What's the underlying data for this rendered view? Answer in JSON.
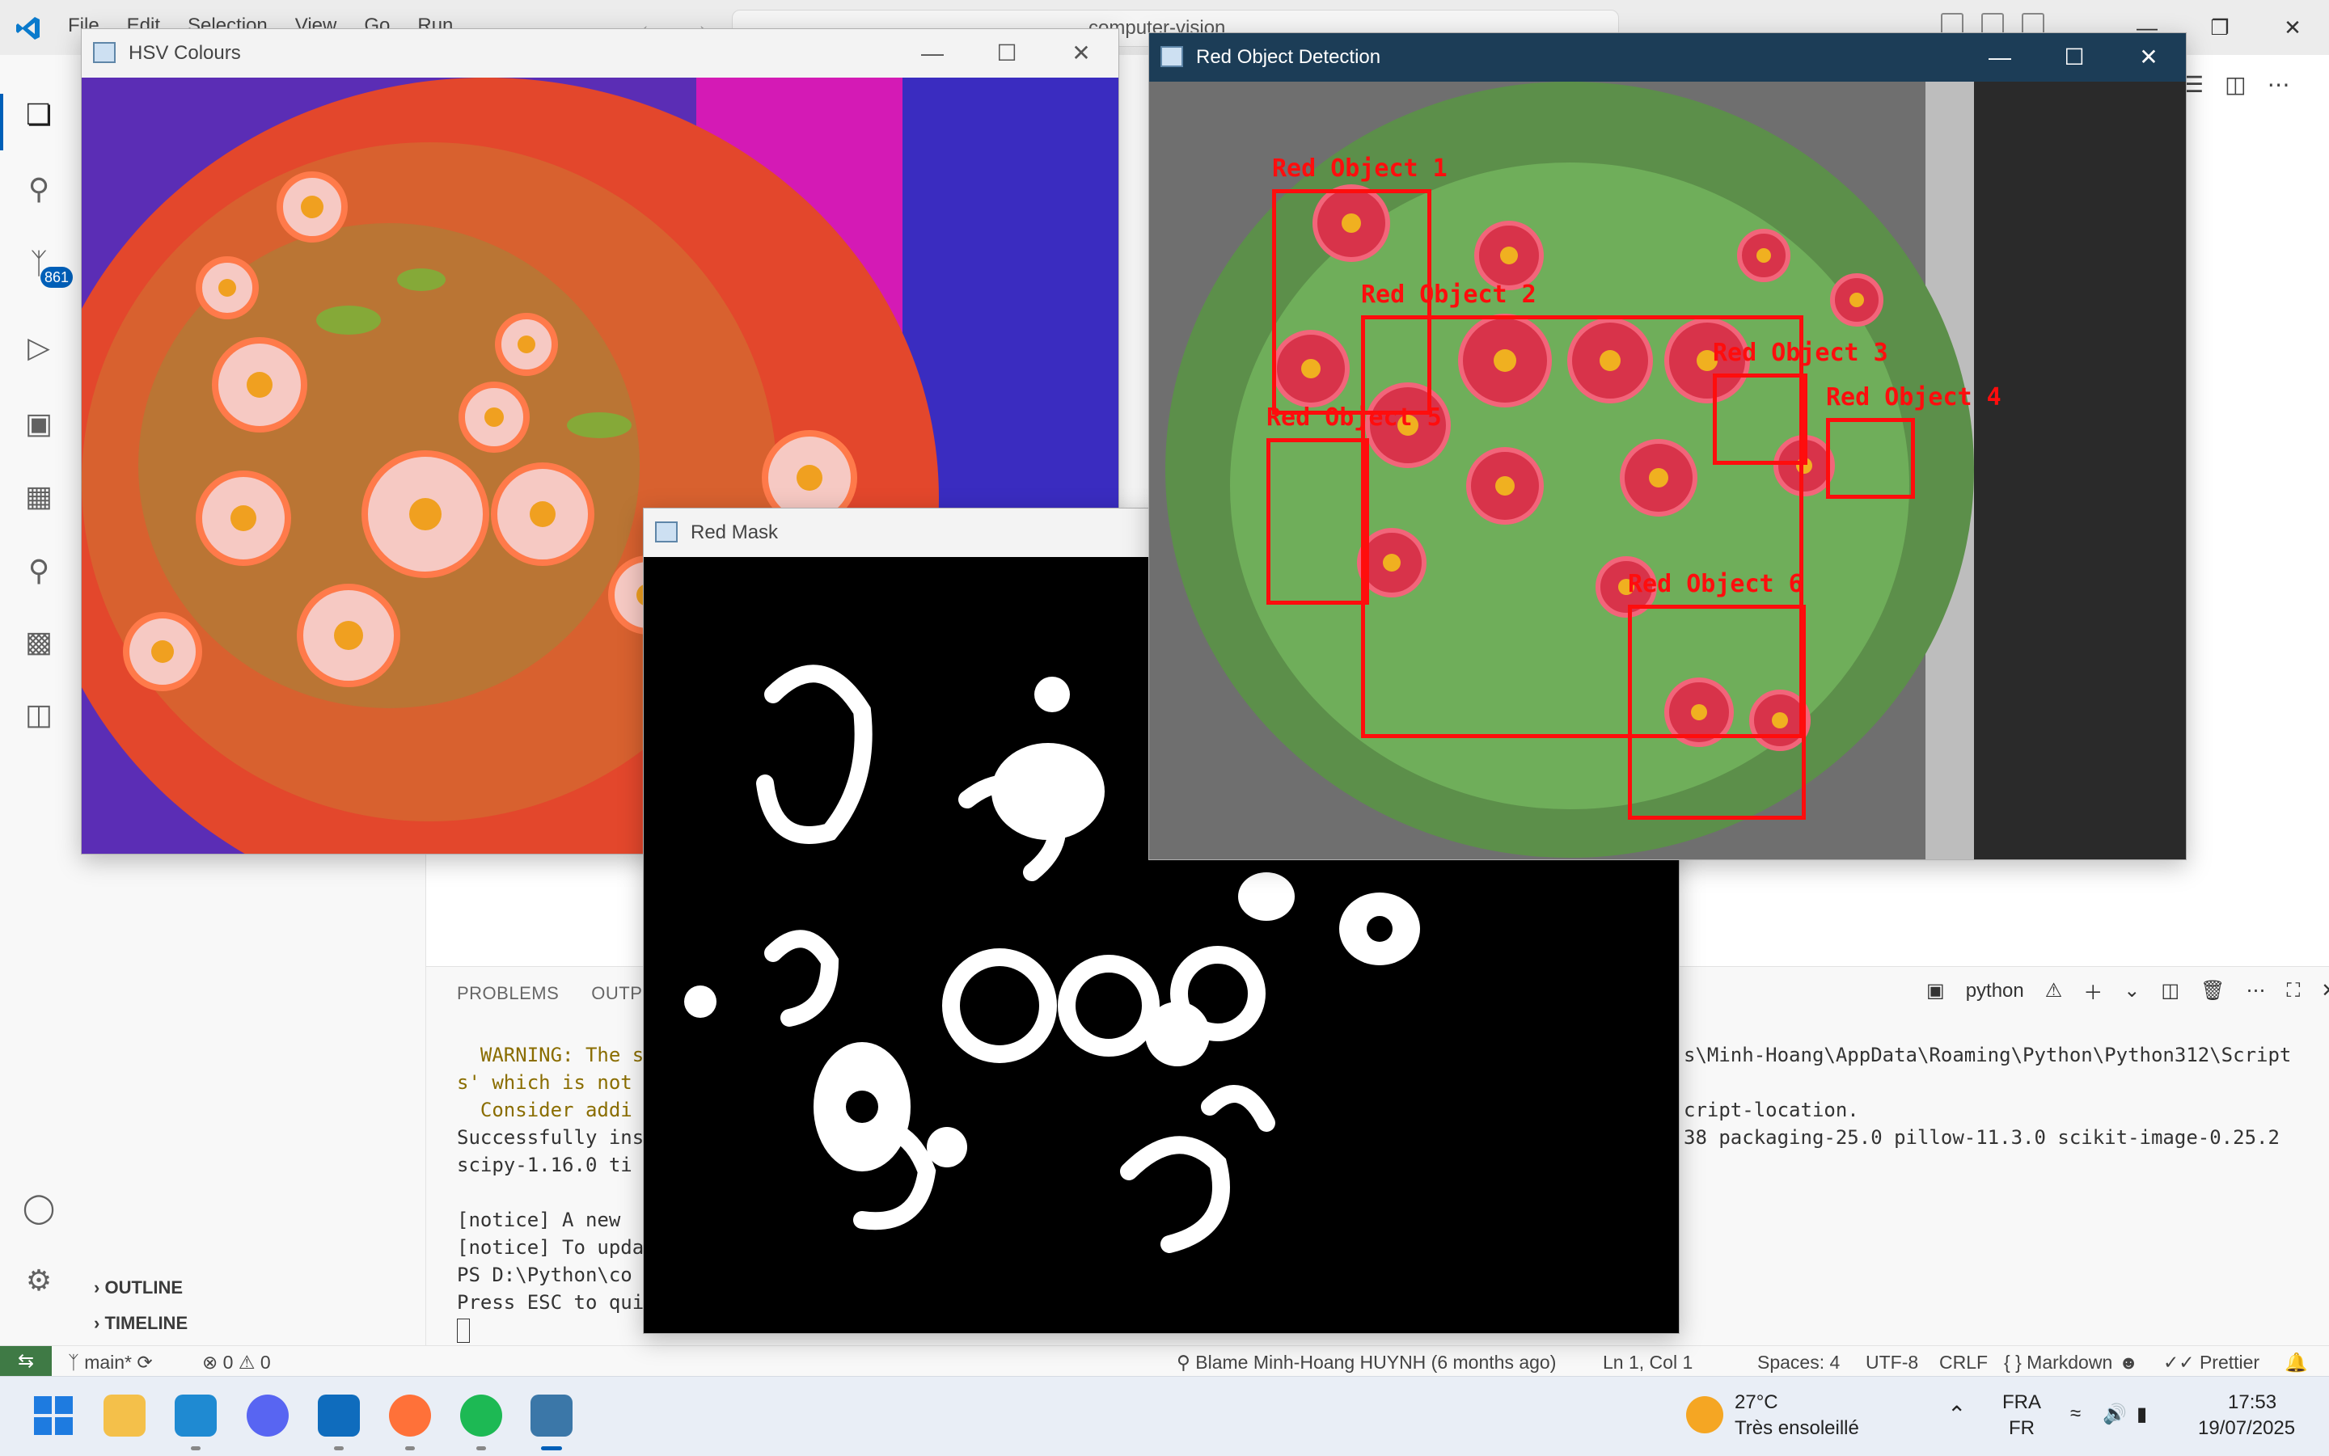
{
  "vscode": {
    "menu": [
      "File",
      "Edit",
      "Selection",
      "View",
      "Go",
      "Run",
      "…"
    ],
    "search_text": "computer-vision",
    "sidebar": {
      "outline": "OUTLINE",
      "timeline": "TIMELINE"
    },
    "source_control_badge": "861",
    "panel": {
      "tabs": [
        "PROBLEMS",
        "OUTPUT"
      ],
      "terminal_name": "python",
      "lines_left": [
        "  WARNING: The s",
        "s' which is not",
        "  Consider addi",
        "Successfully ins",
        "scipy-1.16.0 ti",
        "",
        "[notice] A new ",
        "[notice] To upda",
        "PS D:\\Python\\co",
        "Press ESC to qui"
      ],
      "lines_right": [
        "s\\Minh-Hoang\\AppData\\Roaming\\Python\\Python312\\Script",
        "",
        "cript-location.",
        "38 packaging-25.0 pillow-11.3.0 scikit-image-0.25.2"
      ]
    },
    "status": {
      "branch": "main*",
      "problems": "⊗ 0 ⚠ 0",
      "blame": "Blame Minh-Hoang HUYNH (6 months ago)",
      "position": "Ln 1, Col 1",
      "spaces": "Spaces: 4",
      "encoding": "UTF-8",
      "eol": "CRLF",
      "language": "Markdown",
      "formatter": "Prettier"
    }
  },
  "windows": {
    "hsv": {
      "title": "HSV Colours"
    },
    "mask": {
      "title": "Red Mask"
    },
    "detect": {
      "title": "Red Object Detection",
      "labels": [
        "Red Object 1",
        "Red Object 2",
        "Red Object 3",
        "Red Object 4",
        "Red Object 5",
        "Red Object 6"
      ]
    }
  },
  "taskbar": {
    "weather_temp": "27°C",
    "weather_desc": "Très ensoleillé",
    "lang_top": "FRA",
    "lang_bottom": "FR",
    "time": "17:53",
    "date": "19/07/2025"
  }
}
